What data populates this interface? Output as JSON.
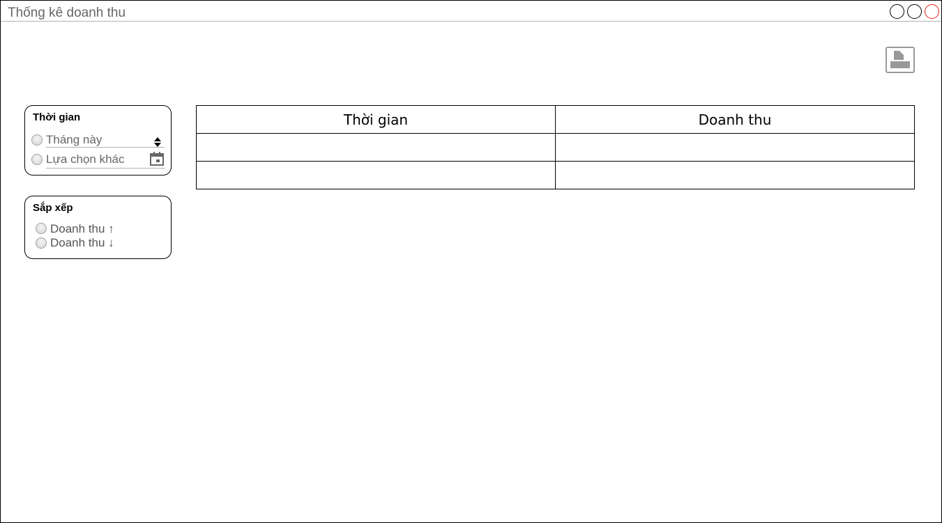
{
  "window": {
    "title": "Thống kê doanh thu"
  },
  "time_filter": {
    "title": "Thời gian",
    "options": [
      {
        "label": "Tháng này"
      },
      {
        "label": "Lựa chọn khác"
      }
    ]
  },
  "sort": {
    "title": "Sắp xếp",
    "options": [
      {
        "label": "Doanh thu ↑"
      },
      {
        "label": "Doanh thu ↓"
      }
    ]
  },
  "table": {
    "columns": [
      "Thời gian",
      "Doanh thu"
    ],
    "rows": [
      [
        "",
        ""
      ],
      [
        "",
        ""
      ]
    ]
  },
  "colors": {
    "close_button": "#e02020",
    "title_text": "#666666"
  },
  "icons": {
    "export": "export-icon",
    "stepper": "stepper-icon",
    "calendar": "calendar-icon"
  }
}
